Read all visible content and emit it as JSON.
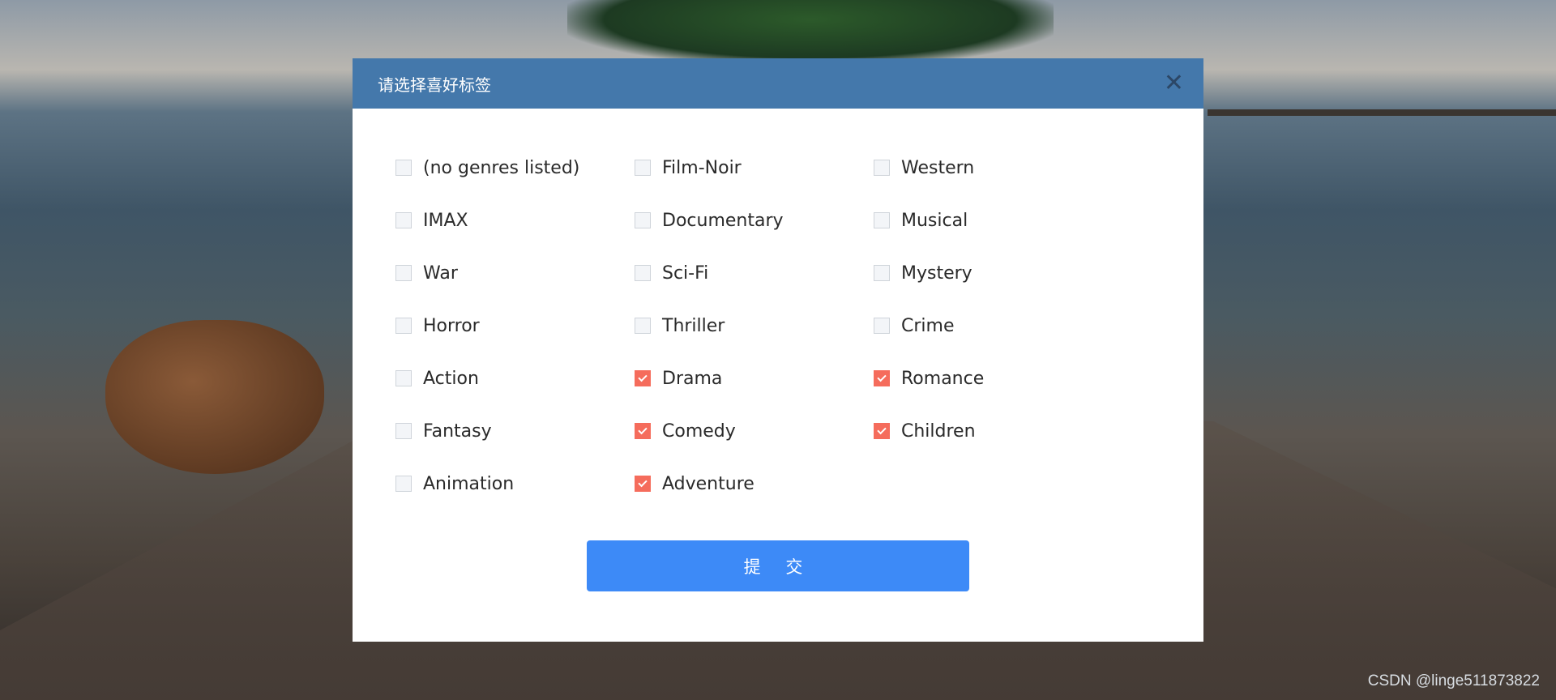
{
  "dialog": {
    "title": "请选择喜好标签",
    "close_icon": "close-icon",
    "submit_label": "提 交"
  },
  "genres": [
    {
      "label": "(no genres listed)",
      "checked": false
    },
    {
      "label": "Film-Noir",
      "checked": false
    },
    {
      "label": "Western",
      "checked": false
    },
    {
      "label": "IMAX",
      "checked": false
    },
    {
      "label": "Documentary",
      "checked": false
    },
    {
      "label": "Musical",
      "checked": false
    },
    {
      "label": "War",
      "checked": false
    },
    {
      "label": "Sci-Fi",
      "checked": false
    },
    {
      "label": "Mystery",
      "checked": false
    },
    {
      "label": "Horror",
      "checked": false
    },
    {
      "label": "Thriller",
      "checked": false
    },
    {
      "label": "Crime",
      "checked": false
    },
    {
      "label": "Action",
      "checked": false
    },
    {
      "label": "Drama",
      "checked": true
    },
    {
      "label": "Romance",
      "checked": true
    },
    {
      "label": "Fantasy",
      "checked": false
    },
    {
      "label": "Comedy",
      "checked": true
    },
    {
      "label": "Children",
      "checked": true
    },
    {
      "label": "Animation",
      "checked": false
    },
    {
      "label": "Adventure",
      "checked": true
    }
  ],
  "colors": {
    "header": "#4478ab",
    "checked": "#f56c5c",
    "submit": "#3d8af7"
  },
  "watermark": "CSDN @linge511873822"
}
